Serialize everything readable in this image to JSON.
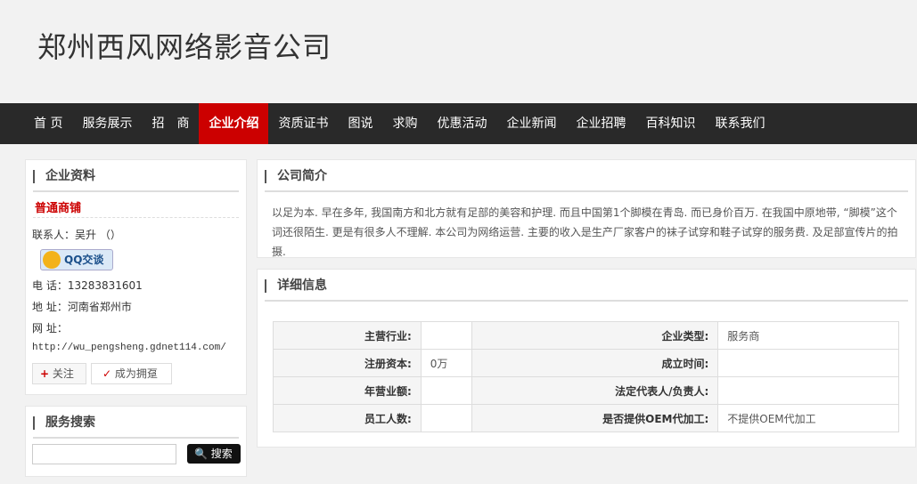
{
  "company_name": "郑州西风网络影音公司",
  "nav": [
    "首 页",
    "服务展示",
    "招　商",
    "企业介绍",
    "资质证书",
    "图说",
    "求购",
    "优惠活动",
    "企业新闻",
    "企业招聘",
    "百科知识",
    "联系我们"
  ],
  "nav_active": "企业介绍",
  "profile": {
    "title": "企业资料",
    "shop_type": "普通商铺",
    "contact": "联系人：吴升 （）",
    "qq_label": "QQ交谈",
    "phone": "电 话：13283831601",
    "address": "地 址：河南省郑州市",
    "website_label": "网 址：",
    "website": "http://wu_pengsheng.gdnet114.com/",
    "follow": "关注",
    "become_fan": "成为拥趸"
  },
  "search": {
    "title": "服务搜索",
    "placeholder": "",
    "button": "搜索"
  },
  "intro": {
    "title": "公司简介",
    "text": "以足为本. 早在多年, 我国南方和北方就有足部的美容和护理. 而且中国第1个脚模在青岛. 而已身价百万. 在我国中原地带, “脚模”这个词还很陌生. 更是有很多人不理解. 本公司为网络运营. 主要的收入是生产厂家客户的袜子试穿和鞋子试穿的服务费. 及足部宣传片的拍摄."
  },
  "details": {
    "title": "详细信息",
    "rows": [
      [
        "主营行业:",
        "",
        "企业类型:",
        "服务商"
      ],
      [
        "注册资本:",
        "0万",
        "成立时间:",
        ""
      ],
      [
        "年营业额:",
        "",
        "法定代表人/负责人:",
        ""
      ],
      [
        "员工人数:",
        "",
        "是否提供OEM代加工:",
        "不提供OEM代加工"
      ]
    ]
  },
  "colors": {
    "nav_bg": "#292929",
    "nav_active": "#cc0000",
    "shop_type": "#cc0000"
  }
}
